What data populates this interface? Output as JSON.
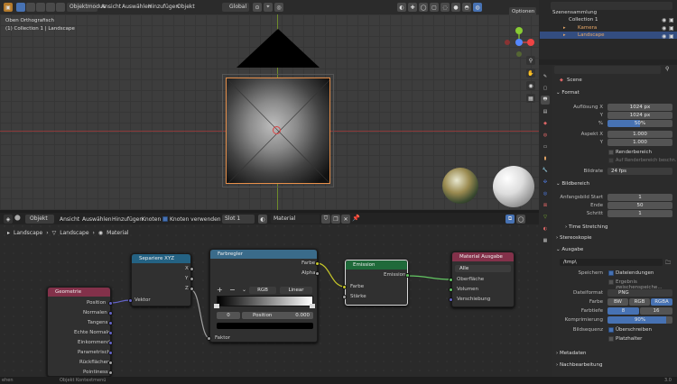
{
  "viewport": {
    "header_items": [
      "Objektmodus",
      "Ansicht",
      "Auswählen",
      "Hinzufügen",
      "Objekt"
    ],
    "global": "Global",
    "optionen": "Optionen",
    "view_name": "Oben Orthografisch",
    "collection_info": "(1) Collection 1 | Landscape"
  },
  "node_editor": {
    "header": {
      "editor_type": "Objekt",
      "menu": [
        "Ansicht",
        "Auswählen",
        "Hinzufügen",
        "Knoten"
      ],
      "use_nodes": "Knoten verwenden",
      "slot": "Slot 1",
      "material": "Material"
    },
    "breadcrumb": [
      "Landscape",
      "Landscape",
      "Material"
    ],
    "nodes": {
      "geometrie": {
        "title": "Geometrie",
        "outputs": [
          "Position",
          "Normalen",
          "Tangens",
          "Echte Normale",
          "Einkommend",
          "Parametrisch",
          "Rückflächen",
          "Pointiness"
        ]
      },
      "separate": {
        "title": "Separiere XYZ",
        "outputs": [
          "X",
          "Y",
          "Z"
        ],
        "input": "Vektor"
      },
      "farbregler": {
        "title": "Farbregler",
        "outputs": [
          "Farbe",
          "Alpha"
        ],
        "mode": "RGB",
        "interp": "Linear",
        "index": "0",
        "pos_label": "Position",
        "pos_value": "0.000",
        "input": "Faktor"
      },
      "emission": {
        "title": "Emission",
        "output": "Emission",
        "inputs": [
          "Farbe",
          "Stärke"
        ]
      },
      "material_output": {
        "title": "Material Ausgabe",
        "target": "Alle",
        "inputs": [
          "Oberfläche",
          "Volumen",
          "Verschiebung"
        ]
      }
    }
  },
  "outliner": {
    "title": "Szenensammlung",
    "items": [
      "Collection 1",
      "Kamera",
      "Landscape"
    ]
  },
  "properties": {
    "scene": "Scene",
    "format": {
      "title": "Format",
      "res_x_label": "Auflösung X",
      "res_x": "1024 px",
      "res_y_label": "Y",
      "res_y": "1024 px",
      "pct_label": "%",
      "pct": "50%",
      "aspect_x_label": "Aspekt X",
      "aspect_x": "1.000",
      "aspect_y_label": "Y",
      "aspect_y": "1.000",
      "renderbereich": "Renderbereich",
      "auf_renderbereich": "Auf Renderbereich beschn.",
      "fps_label": "Bildrate",
      "fps": "24 fps"
    },
    "frame_range": {
      "title": "Bildbereich",
      "start_label": "Anfangsbild Start",
      "start": "1",
      "end_label": "Ende",
      "end": "50",
      "step_label": "Schritt",
      "step": "1",
      "time_stretching": "Time Stretching",
      "stereoskopie": "Stereoskopie"
    },
    "output": {
      "title": "Ausgabe",
      "path": "/tmp\\",
      "save_label": "Speichern",
      "dateiendungen": "Dateiendungen",
      "ergebnis": "Ergebnis zwischenspeiche...",
      "format_label": "Dateiformat",
      "format": "PNG",
      "color_label": "Farbe",
      "bw": "BW",
      "rgb": "RGB",
      "rgba": "RGBA",
      "depth_label": "Farbtiefe",
      "depth8": "8",
      "depth16": "16",
      "compress_label": "Komprimierung",
      "compress": "90%",
      "seq_label": "Bildsequenz",
      "overwrite": "Überschreiben",
      "placeholder": "Platzhalter"
    },
    "metadata": "Metadaten",
    "postproc": "Nachbearbeitung"
  },
  "status": {
    "left": "ehen",
    "mid": "Objekt Kontextmenü",
    "version": "3.0"
  }
}
